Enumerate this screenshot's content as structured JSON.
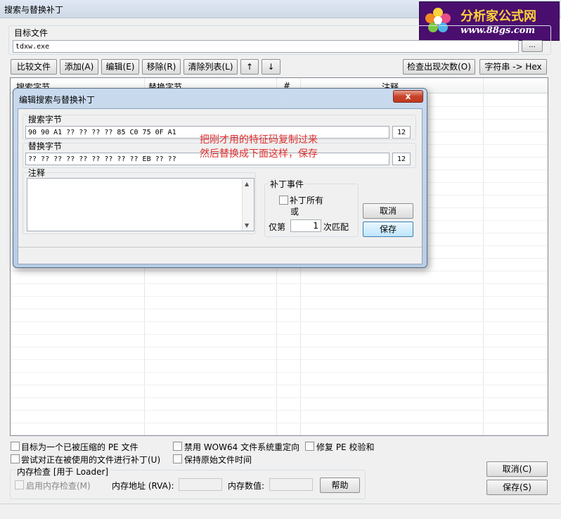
{
  "window": {
    "title": "搜索与替换补丁"
  },
  "logo": {
    "line1": "分析家公式网",
    "line2": "www.88gs.com"
  },
  "target": {
    "label": "目标文件",
    "value": "tdxw.exe",
    "browse_label": "..."
  },
  "toolbar": {
    "compare": "比较文件",
    "add": "添加(A)",
    "edit": "编辑(E)",
    "remove": "移除(R)",
    "clear": "清除列表(L)",
    "up": "↑",
    "down": "↓",
    "check_count": "检查出现次数(O)",
    "string_hex": "字符串 -> Hex"
  },
  "grid": {
    "columns": [
      "搜索字节",
      "替换字节",
      "#",
      "注释"
    ]
  },
  "dialog": {
    "title": "编辑搜索与替换补丁",
    "close": "x",
    "search_label": "搜索字节",
    "search_value": "90 90 A1 ?? ?? ?? ?? 85 C0 75 0F A1",
    "search_count": "12",
    "replace_label": "替换字节",
    "replace_value": "?? ?? ?? ?? ?? ?? ?? ?? ?? EB ?? ??",
    "replace_count": "12",
    "comment_label": "注释",
    "patch_group": "补丁事件",
    "patch_all": "补丁所有",
    "or": "或",
    "only_nth": "仅第",
    "nth_value": "1",
    "nth_suffix": "次匹配",
    "cancel": "取消",
    "save": "保存"
  },
  "annotation": {
    "line1": "把刚才用的特征码复制过来",
    "line2": "然后替换成下面这样，保存"
  },
  "options": {
    "compressed_pe": "目标为一个已被压缩的 PE 文件",
    "disable_wow64": "禁用 WOW64 文件系统重定向",
    "fix_pe_checksum": "修复 PE 校验和",
    "patch_in_use": "尝试对正在被使用的文件进行补丁(U)",
    "keep_time": "保持原始文件时间"
  },
  "memory": {
    "group": "内存检查 [用于 Loader]",
    "enable": "启用内存检查(M)",
    "address_label": "内存地址 (RVA):",
    "value_label": "内存数值:",
    "help": "帮助"
  },
  "footer": {
    "cancel": "取消(C)",
    "save": "保存(S)"
  }
}
